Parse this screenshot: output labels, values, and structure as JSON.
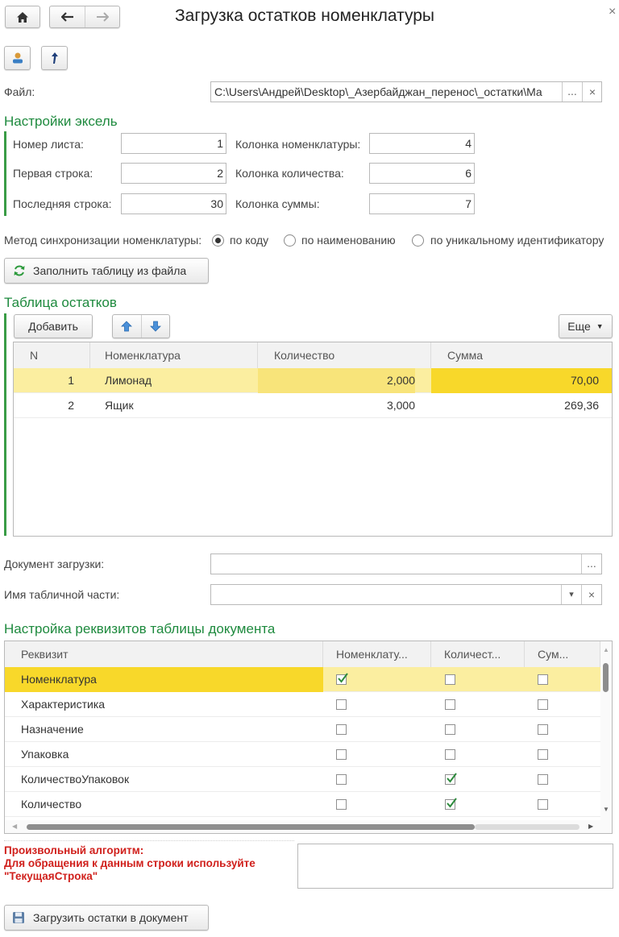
{
  "window": {
    "title": "Загрузка остатков номенклатуры",
    "close_glyph": "×"
  },
  "file": {
    "label": "Файл:",
    "value": "C:\\Users\\Андрей\\Desktop\\_Азербайджан_перенос\\_остатки\\Ма",
    "browse_glyph": "...",
    "clear_glyph": "×"
  },
  "excel": {
    "title": "Настройки эксель",
    "sheet_label": "Номер листа:",
    "sheet_value": "1",
    "first_row_label": "Первая строка:",
    "first_row_value": "2",
    "last_row_label": "Последняя строка:",
    "last_row_value": "30",
    "nom_col_label": "Колонка номенклатуры:",
    "nom_col_value": "4",
    "qty_col_label": "Колонка количества:",
    "qty_col_value": "6",
    "sum_col_label": "Колонка суммы:",
    "sum_col_value": "7"
  },
  "sync": {
    "label": "Метод синхронизации номенклатуры:",
    "options": [
      "по коду",
      "по наименованию",
      "по уникальному идентификатору"
    ],
    "selected": 0
  },
  "fill_button": "Заполнить таблицу из файла",
  "stock": {
    "title": "Таблица остатков",
    "add_button": "Добавить",
    "more_button": "Еще",
    "columns": [
      "N",
      "Номенклатура",
      "Количество",
      "Сумма"
    ],
    "rows": [
      {
        "n": "1",
        "name": "Лимонад",
        "qty": "2,000",
        "sum": "70,00"
      },
      {
        "n": "2",
        "name": "Ящик",
        "qty": "3,000",
        "sum": "269,36"
      }
    ]
  },
  "doc": {
    "label": "Документ загрузки:",
    "value": "",
    "browse_glyph": "..."
  },
  "tabpart": {
    "label": "Имя табличной части:",
    "value": "",
    "dropdown_glyph": "▾",
    "clear_glyph": "×"
  },
  "attrs": {
    "title": "Настройка реквизитов таблицы документа",
    "columns": [
      "Реквизит",
      "Номенклату...",
      "Количест...",
      "Сум..."
    ],
    "rows": [
      {
        "name": "Номенклатура",
        "nom": true,
        "qty": false,
        "sum": false
      },
      {
        "name": "Характеристика",
        "nom": false,
        "qty": false,
        "sum": false
      },
      {
        "name": "Назначение",
        "nom": false,
        "qty": false,
        "sum": false
      },
      {
        "name": "Упаковка",
        "nom": false,
        "qty": false,
        "sum": false
      },
      {
        "name": "КоличествоУпаковок",
        "nom": false,
        "qty": true,
        "sum": false
      },
      {
        "name": "Количество",
        "nom": false,
        "qty": true,
        "sum": false
      }
    ]
  },
  "algo": {
    "line1": "Произвольный алгоритм:",
    "line2": "Для обращения к данным строки используйте",
    "line3": "\"ТекущаяСтрока\"",
    "value": ""
  },
  "load_button": "Загрузить остатки в документ",
  "colors": {
    "section_green": "#1e8a3e",
    "row_highlight": "#fbeea0",
    "cell_highlight": "#f8d82a",
    "warning_red": "#d0201c"
  }
}
